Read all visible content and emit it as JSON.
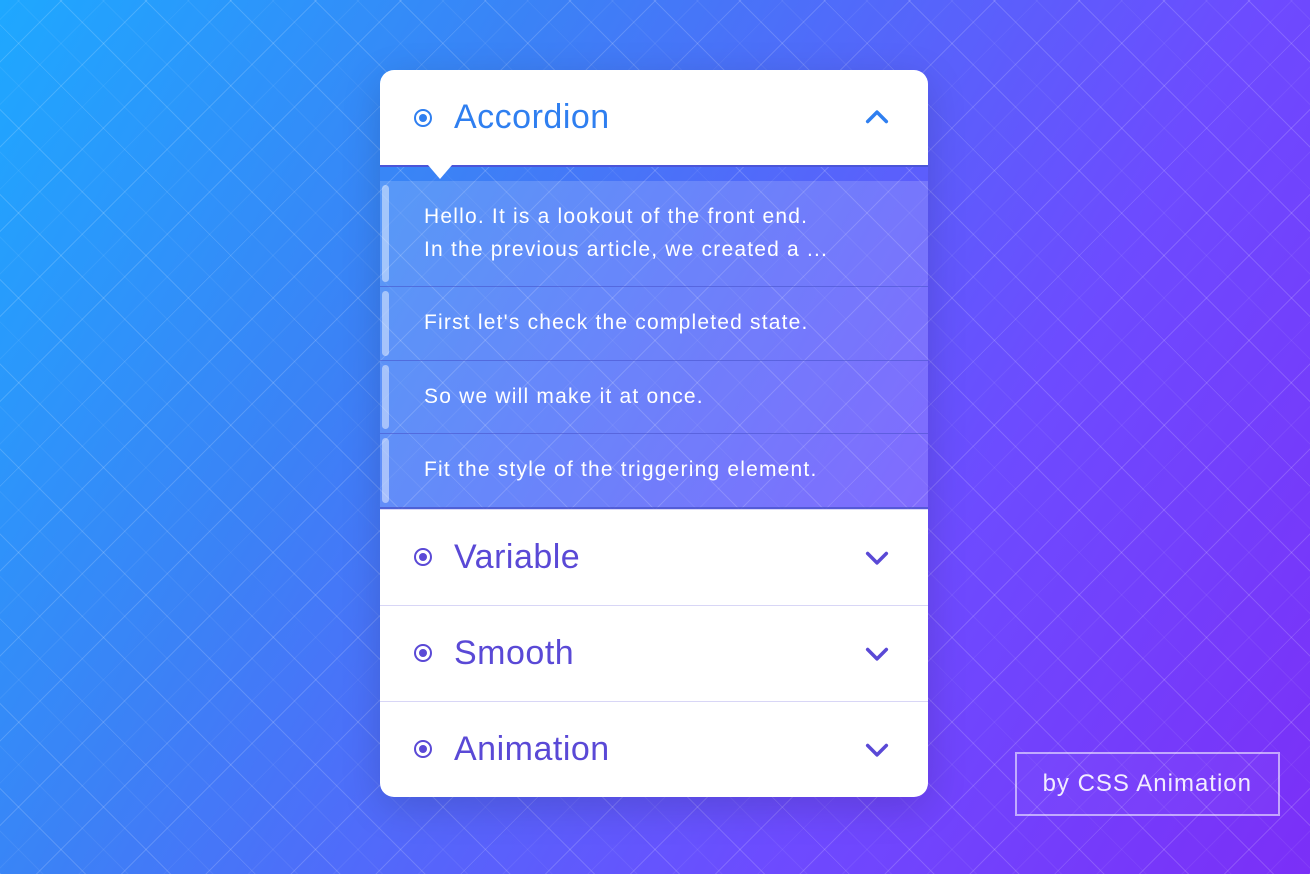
{
  "accordion": {
    "sections": [
      {
        "title": "Accordion",
        "open": true,
        "items": [
          "Hello. It is a lookout of the front end.\nIn the previous article, we created a ...",
          "First let's check the completed state.",
          "So we will make it at once.",
          "Fit the style of the triggering element."
        ]
      },
      {
        "title": "Variable",
        "open": false
      },
      {
        "title": "Smooth",
        "open": false
      },
      {
        "title": "Animation",
        "open": false
      }
    ]
  },
  "credit": "by CSS Animation"
}
